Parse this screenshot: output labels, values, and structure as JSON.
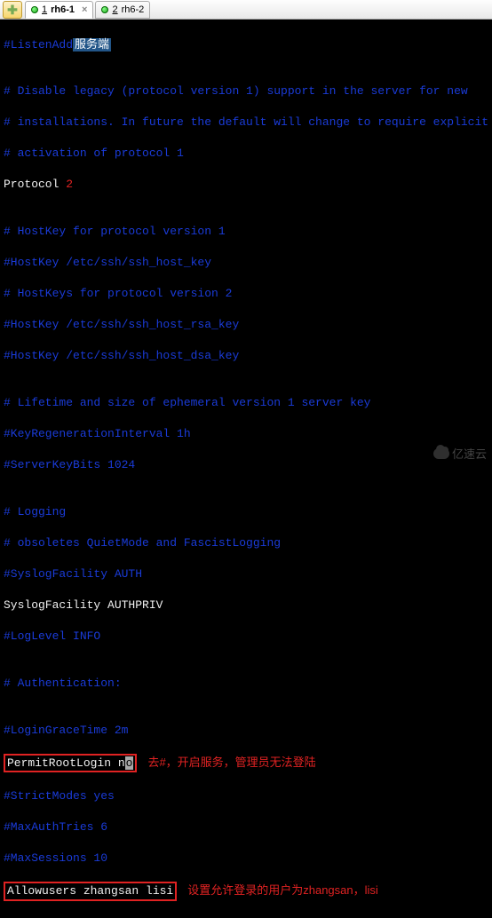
{
  "tabs": {
    "add_tooltip": "Add",
    "items": [
      {
        "index": "1",
        "label": "rh6-1",
        "active": true,
        "closeable": true
      },
      {
        "index": "2",
        "label": "rh6-2",
        "active": false,
        "closeable": false
      }
    ]
  },
  "annotations": {
    "server_side": "服务端",
    "protocol_note": "2",
    "permit_root_note": "去#，开启服务，管理员无法登陆",
    "allowusers_note": "设置允许登录的用户为zhangsan，lisi"
  },
  "config": {
    "l01a": "#ListenAdd",
    "l02": "",
    "l03": "# Disable legacy (protocol version 1) support in the server for new",
    "l04": "# installations. In future the default will change to require explicit",
    "l05": "# activation of protocol 1",
    "l06a": "Protocol ",
    "l07": "",
    "l08": "# HostKey for protocol version 1",
    "l09": "#HostKey /etc/ssh/ssh_host_key",
    "l10": "# HostKeys for protocol version 2",
    "l11": "#HostKey /etc/ssh/ssh_host_rsa_key",
    "l12": "#HostKey /etc/ssh/ssh_host_dsa_key",
    "l13": "",
    "l14": "# Lifetime and size of ephemeral version 1 server key",
    "l15": "#KeyRegenerationInterval 1h",
    "l16": "#ServerKeyBits 1024",
    "l17": "",
    "l18": "# Logging",
    "l19": "# obsoletes QuietMode and FascistLogging",
    "l20": "#SyslogFacility AUTH",
    "l21": "SyslogFacility AUTHPRIV",
    "l22": "#LogLevel INFO",
    "l23": "",
    "l24": "# Authentication:",
    "l25": "",
    "l26": "#LoginGraceTime 2m",
    "l27_box_a": "PermitRootLogin n",
    "l27_box_b": "o",
    "l28": "#StrictModes yes",
    "l29": "#MaxAuthTries 6",
    "l30": "#MaxSessions 10",
    "l31_box": "Allowusers zhangsan lisi"
  },
  "footer": {
    "logo_text": "亿速云"
  }
}
